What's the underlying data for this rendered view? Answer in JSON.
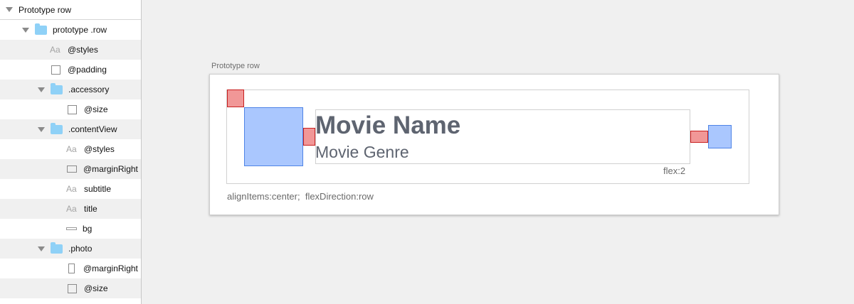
{
  "sidebar": {
    "root_label": "Prototype row",
    "items": [
      {
        "label": "prototype .row",
        "icon": "folder-icon"
      },
      {
        "label": "@styles",
        "icon": "text-style-icon",
        "glyph": "Aa"
      },
      {
        "label": "@padding",
        "icon": "square-icon"
      },
      {
        "label": ".accessory",
        "icon": "folder-icon"
      },
      {
        "label": "@size",
        "icon": "square-icon"
      },
      {
        "label": ".contentView",
        "icon": "folder-icon"
      },
      {
        "label": "@styles",
        "icon": "text-style-icon",
        "glyph": "Aa"
      },
      {
        "label": "@marginRight",
        "icon": "horizontal-rect-icon"
      },
      {
        "label": "subtitle",
        "icon": "text-style-icon",
        "glyph": "Aa"
      },
      {
        "label": "title",
        "icon": "text-style-icon",
        "glyph": "Aa"
      },
      {
        "label": "bg",
        "icon": "line-icon"
      },
      {
        "label": ".photo",
        "icon": "folder-icon"
      },
      {
        "label": "@marginRight",
        "icon": "vertical-rect-icon"
      },
      {
        "label": "@size",
        "icon": "square-icon"
      }
    ]
  },
  "canvas": {
    "prototype_label": "Prototype row",
    "movie_name": "Movie Name",
    "movie_genre": "Movie Genre",
    "flex_label": "flex:2",
    "style_label": "alignItems:center;  flexDirection:row"
  },
  "colors": {
    "margin_red": "#f19797",
    "margin_red_border": "#c82020",
    "box_blue": "#aac7fe",
    "box_blue_border": "#4f84e6",
    "folder_blue": "#8fd1f7",
    "text_gray": "#5e6470"
  }
}
